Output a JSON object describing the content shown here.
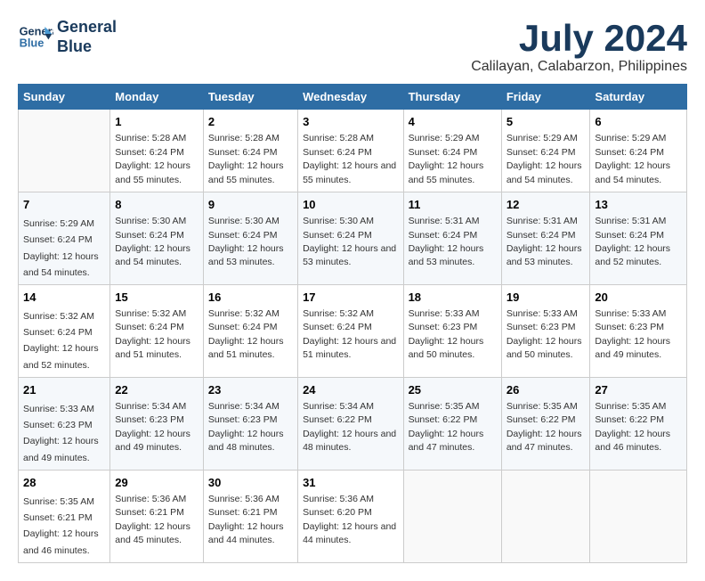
{
  "header": {
    "logo_line1": "General",
    "logo_line2": "Blue",
    "title": "July 2024",
    "subtitle": "Calilayan, Calabarzon, Philippines"
  },
  "days_of_week": [
    "Sunday",
    "Monday",
    "Tuesday",
    "Wednesday",
    "Thursday",
    "Friday",
    "Saturday"
  ],
  "weeks": [
    [
      {
        "day": "",
        "sunrise": "",
        "sunset": "",
        "daylight": ""
      },
      {
        "day": "1",
        "sunrise": "Sunrise: 5:28 AM",
        "sunset": "Sunset: 6:24 PM",
        "daylight": "Daylight: 12 hours and 55 minutes."
      },
      {
        "day": "2",
        "sunrise": "Sunrise: 5:28 AM",
        "sunset": "Sunset: 6:24 PM",
        "daylight": "Daylight: 12 hours and 55 minutes."
      },
      {
        "day": "3",
        "sunrise": "Sunrise: 5:28 AM",
        "sunset": "Sunset: 6:24 PM",
        "daylight": "Daylight: 12 hours and 55 minutes."
      },
      {
        "day": "4",
        "sunrise": "Sunrise: 5:29 AM",
        "sunset": "Sunset: 6:24 PM",
        "daylight": "Daylight: 12 hours and 55 minutes."
      },
      {
        "day": "5",
        "sunrise": "Sunrise: 5:29 AM",
        "sunset": "Sunset: 6:24 PM",
        "daylight": "Daylight: 12 hours and 54 minutes."
      },
      {
        "day": "6",
        "sunrise": "Sunrise: 5:29 AM",
        "sunset": "Sunset: 6:24 PM",
        "daylight": "Daylight: 12 hours and 54 minutes."
      }
    ],
    [
      {
        "day": "7",
        "sunrise": "Sunrise: 5:29 AM",
        "sunset": "Sunset: 6:24 PM",
        "daylight": "Daylight: 12 hours and 54 minutes."
      },
      {
        "day": "8",
        "sunrise": "Sunrise: 5:30 AM",
        "sunset": "Sunset: 6:24 PM",
        "daylight": "Daylight: 12 hours and 54 minutes."
      },
      {
        "day": "9",
        "sunrise": "Sunrise: 5:30 AM",
        "sunset": "Sunset: 6:24 PM",
        "daylight": "Daylight: 12 hours and 53 minutes."
      },
      {
        "day": "10",
        "sunrise": "Sunrise: 5:30 AM",
        "sunset": "Sunset: 6:24 PM",
        "daylight": "Daylight: 12 hours and 53 minutes."
      },
      {
        "day": "11",
        "sunrise": "Sunrise: 5:31 AM",
        "sunset": "Sunset: 6:24 PM",
        "daylight": "Daylight: 12 hours and 53 minutes."
      },
      {
        "day": "12",
        "sunrise": "Sunrise: 5:31 AM",
        "sunset": "Sunset: 6:24 PM",
        "daylight": "Daylight: 12 hours and 53 minutes."
      },
      {
        "day": "13",
        "sunrise": "Sunrise: 5:31 AM",
        "sunset": "Sunset: 6:24 PM",
        "daylight": "Daylight: 12 hours and 52 minutes."
      }
    ],
    [
      {
        "day": "14",
        "sunrise": "Sunrise: 5:32 AM",
        "sunset": "Sunset: 6:24 PM",
        "daylight": "Daylight: 12 hours and 52 minutes."
      },
      {
        "day": "15",
        "sunrise": "Sunrise: 5:32 AM",
        "sunset": "Sunset: 6:24 PM",
        "daylight": "Daylight: 12 hours and 51 minutes."
      },
      {
        "day": "16",
        "sunrise": "Sunrise: 5:32 AM",
        "sunset": "Sunset: 6:24 PM",
        "daylight": "Daylight: 12 hours and 51 minutes."
      },
      {
        "day": "17",
        "sunrise": "Sunrise: 5:32 AM",
        "sunset": "Sunset: 6:24 PM",
        "daylight": "Daylight: 12 hours and 51 minutes."
      },
      {
        "day": "18",
        "sunrise": "Sunrise: 5:33 AM",
        "sunset": "Sunset: 6:23 PM",
        "daylight": "Daylight: 12 hours and 50 minutes."
      },
      {
        "day": "19",
        "sunrise": "Sunrise: 5:33 AM",
        "sunset": "Sunset: 6:23 PM",
        "daylight": "Daylight: 12 hours and 50 minutes."
      },
      {
        "day": "20",
        "sunrise": "Sunrise: 5:33 AM",
        "sunset": "Sunset: 6:23 PM",
        "daylight": "Daylight: 12 hours and 49 minutes."
      }
    ],
    [
      {
        "day": "21",
        "sunrise": "Sunrise: 5:33 AM",
        "sunset": "Sunset: 6:23 PM",
        "daylight": "Daylight: 12 hours and 49 minutes."
      },
      {
        "day": "22",
        "sunrise": "Sunrise: 5:34 AM",
        "sunset": "Sunset: 6:23 PM",
        "daylight": "Daylight: 12 hours and 49 minutes."
      },
      {
        "day": "23",
        "sunrise": "Sunrise: 5:34 AM",
        "sunset": "Sunset: 6:23 PM",
        "daylight": "Daylight: 12 hours and 48 minutes."
      },
      {
        "day": "24",
        "sunrise": "Sunrise: 5:34 AM",
        "sunset": "Sunset: 6:22 PM",
        "daylight": "Daylight: 12 hours and 48 minutes."
      },
      {
        "day": "25",
        "sunrise": "Sunrise: 5:35 AM",
        "sunset": "Sunset: 6:22 PM",
        "daylight": "Daylight: 12 hours and 47 minutes."
      },
      {
        "day": "26",
        "sunrise": "Sunrise: 5:35 AM",
        "sunset": "Sunset: 6:22 PM",
        "daylight": "Daylight: 12 hours and 47 minutes."
      },
      {
        "day": "27",
        "sunrise": "Sunrise: 5:35 AM",
        "sunset": "Sunset: 6:22 PM",
        "daylight": "Daylight: 12 hours and 46 minutes."
      }
    ],
    [
      {
        "day": "28",
        "sunrise": "Sunrise: 5:35 AM",
        "sunset": "Sunset: 6:21 PM",
        "daylight": "Daylight: 12 hours and 46 minutes."
      },
      {
        "day": "29",
        "sunrise": "Sunrise: 5:36 AM",
        "sunset": "Sunset: 6:21 PM",
        "daylight": "Daylight: 12 hours and 45 minutes."
      },
      {
        "day": "30",
        "sunrise": "Sunrise: 5:36 AM",
        "sunset": "Sunset: 6:21 PM",
        "daylight": "Daylight: 12 hours and 44 minutes."
      },
      {
        "day": "31",
        "sunrise": "Sunrise: 5:36 AM",
        "sunset": "Sunset: 6:20 PM",
        "daylight": "Daylight: 12 hours and 44 minutes."
      },
      {
        "day": "",
        "sunrise": "",
        "sunset": "",
        "daylight": ""
      },
      {
        "day": "",
        "sunrise": "",
        "sunset": "",
        "daylight": ""
      },
      {
        "day": "",
        "sunrise": "",
        "sunset": "",
        "daylight": ""
      }
    ]
  ]
}
